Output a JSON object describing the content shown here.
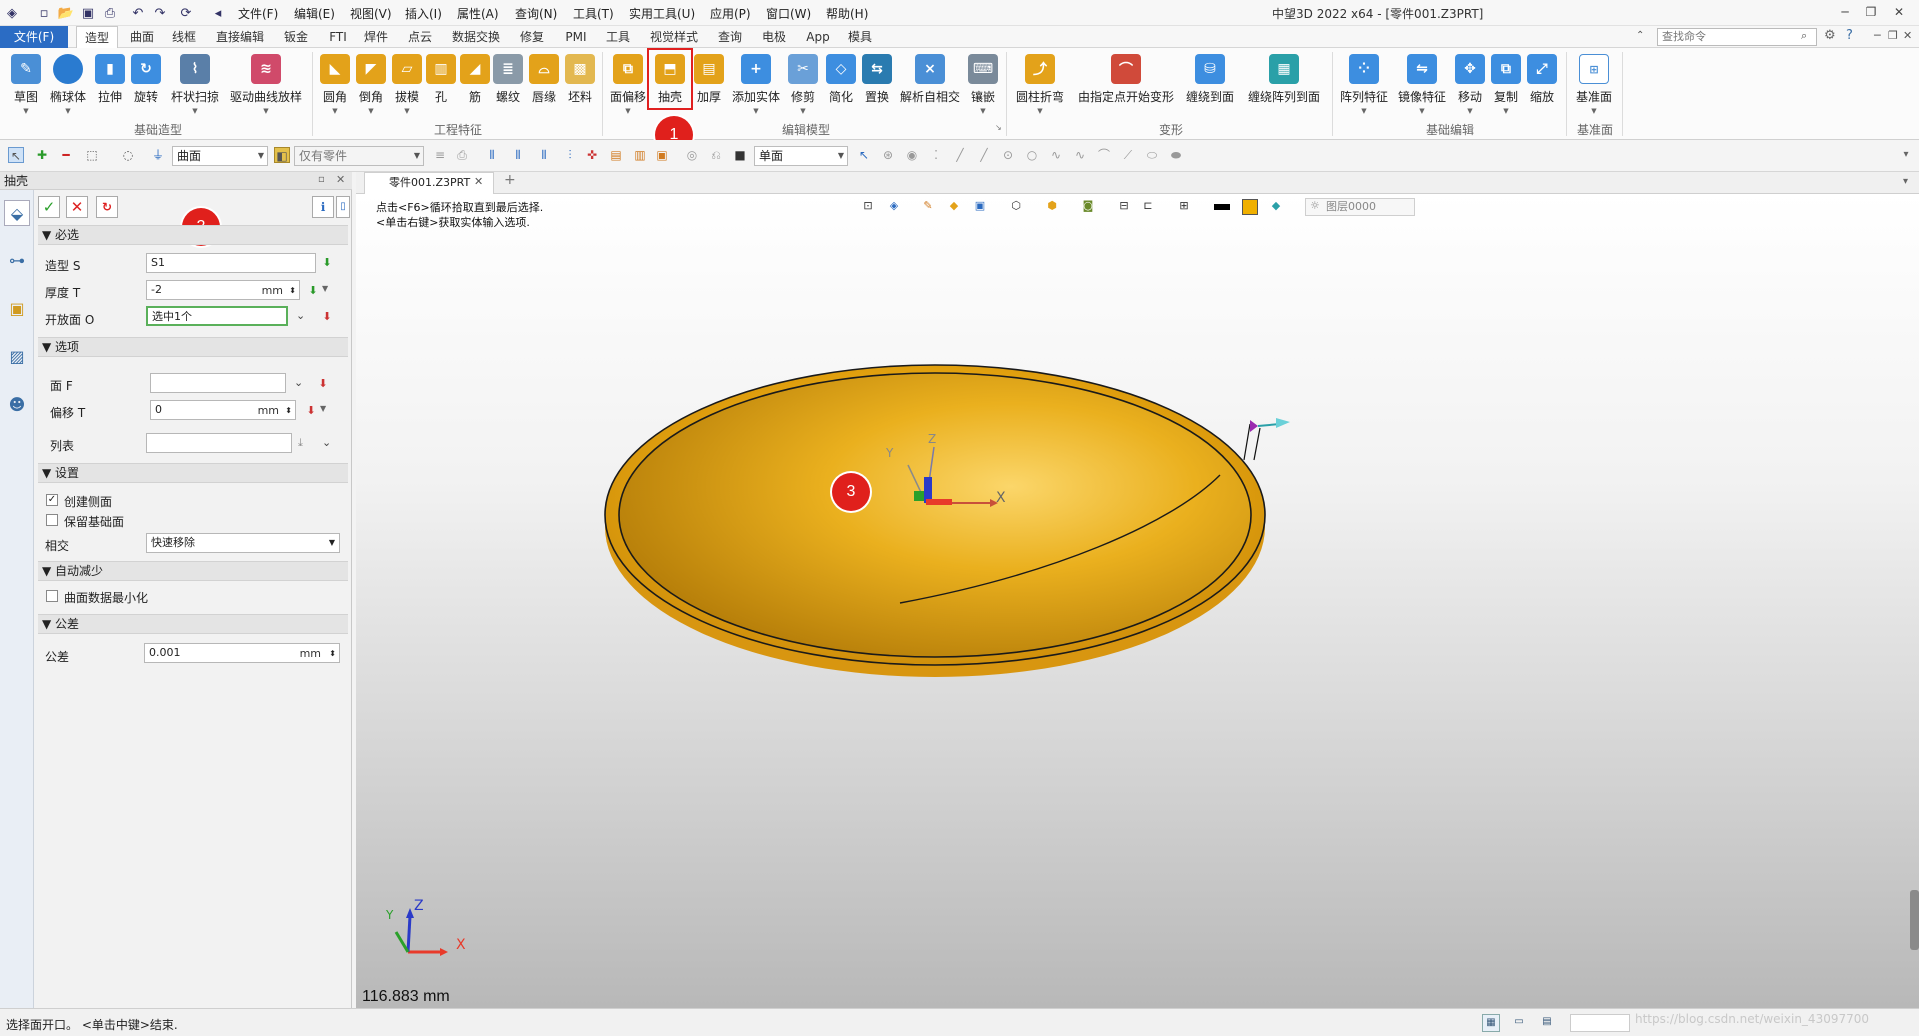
{
  "titlebar": {
    "title": "中望3D 2022 x64 - [零件001.Z3PRT]",
    "menu": [
      "文件(F)",
      "编辑(E)",
      "视图(V)",
      "插入(I)",
      "属性(A)",
      "查询(N)",
      "工具(T)",
      "实用工具(U)",
      "应用(P)",
      "窗口(W)",
      "帮助(H)"
    ],
    "window_controls": [
      "minimize-icon",
      "restore-icon",
      "close-icon"
    ]
  },
  "ribbon": {
    "file_tab": "文件(F)",
    "tabs": [
      "造型",
      "曲面",
      "线框",
      "直接编辑",
      "钣金",
      "FTI",
      "焊件",
      "点云",
      "数据交换",
      "修复",
      "PMI",
      "工具",
      "视觉样式",
      "查询",
      "电极",
      "App",
      "模具"
    ],
    "active_tab": "造型",
    "search_placeholder": "查找命令",
    "groups": [
      {
        "label": "基础造型",
        "buttons": [
          "草图",
          "椭球体",
          "拉伸",
          "旋转",
          "杆状扫掠",
          "驱动曲线放样"
        ]
      },
      {
        "label": "工程特征",
        "buttons": [
          "圆角",
          "倒角",
          "拔模",
          "孔",
          "筋",
          "螺纹",
          "唇缘",
          "坯料"
        ]
      },
      {
        "label": "编辑模型",
        "buttons": [
          "面偏移",
          "抽壳",
          "加厚",
          "添加实体",
          "修剪",
          "简化",
          "置换",
          "解析自相交",
          "镶嵌"
        ]
      },
      {
        "label": "变形",
        "buttons": [
          "圆柱折弯",
          "由指定点开始变形",
          "缠绕到面",
          "缠绕阵列到面"
        ]
      },
      {
        "label": "基础编辑",
        "buttons": [
          "阵列特征",
          "镜像特征",
          "移动",
          "复制",
          "缩放"
        ]
      },
      {
        "label": "基准面",
        "buttons": [
          "基准面"
        ]
      }
    ],
    "highlighted_button": "抽壳"
  },
  "markers": [
    "1",
    "2",
    "3"
  ],
  "toolbar": {
    "filter_value": "曲面",
    "scope_value": "仅有零件",
    "view_value": "单面"
  },
  "panel": {
    "title": "抽壳",
    "sections": {
      "required": "必选",
      "options": "选项",
      "settings": "设置",
      "auto_reduce": "自动减少",
      "tolerance": "公差"
    },
    "fields": {
      "shape_label": "造型 S",
      "shape_value": "S1",
      "thickness_label": "厚度 T",
      "thickness_value": "-2",
      "thickness_unit": "mm",
      "open_face_label": "开放面 O",
      "open_face_value": "选中1个",
      "face_label": "面 F",
      "face_value": "",
      "offset_label": "偏移 T",
      "offset_value": "0",
      "offset_unit": "mm",
      "list_label": "列表",
      "create_side_label": "创建侧面",
      "create_side_checked": true,
      "keep_base_label": "保留基础面",
      "keep_base_checked": false,
      "intersect_label": "相交",
      "intersect_value": "快速移除",
      "minimize_label": "曲面数据最小化",
      "minimize_checked": false,
      "tolerance_label": "公差",
      "tolerance_value": "0.001",
      "tolerance_unit": "mm"
    }
  },
  "document": {
    "tab_label": "零件001.Z3PRT",
    "hint_line1": "点击<F6>循环拾取直到最后选择.",
    "hint_line2": "<单击右键>获取实体输入选项.",
    "layer_value": "图层0000",
    "scale_text": "116.883 mm",
    "axis_labels": [
      "X",
      "Y",
      "Z"
    ],
    "part_color": "#E8AA10"
  },
  "status": {
    "text": "选择面开口。 <单击中键>结束.",
    "watermark": "https://blog.csdn.net/weixin_43097700"
  }
}
